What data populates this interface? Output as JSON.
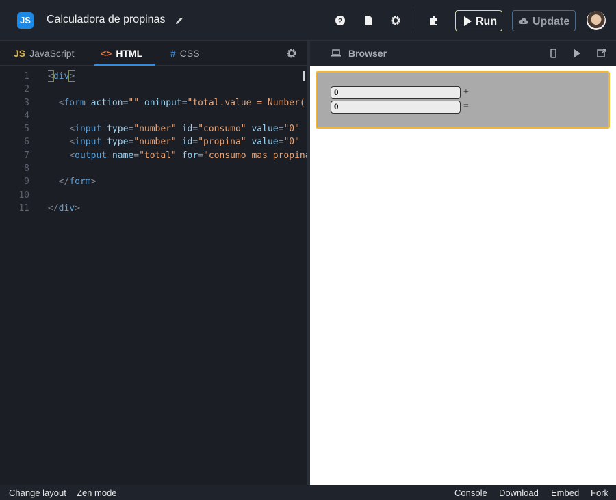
{
  "app": {
    "logo": "JS",
    "title": "Calculadora de propinas",
    "run_label": "Run",
    "update_label": "Update"
  },
  "editor": {
    "tabs": [
      {
        "tag": "JS",
        "label": "JavaScript"
      },
      {
        "tag": "<>",
        "label": "HTML"
      },
      {
        "tag": "#",
        "label": "CSS"
      }
    ],
    "active_tab": "HTML",
    "line_numbers": [
      "1",
      "2",
      "3",
      "4",
      "5",
      "6",
      "7",
      "8",
      "9",
      "10",
      "11"
    ]
  },
  "browser": {
    "title": "Browser",
    "input1_value": "0",
    "input2_value": "0",
    "op1": "+",
    "op2": "="
  },
  "statusbar": {
    "change_layout": "Change layout",
    "zen_mode": "Zen mode",
    "console": "Console",
    "download": "Download",
    "embed": "Embed",
    "fork": "Fork"
  },
  "colors": {
    "accent": "#2f8de4",
    "run_border": "#c6e28a",
    "preview_border": "#f2b632"
  }
}
